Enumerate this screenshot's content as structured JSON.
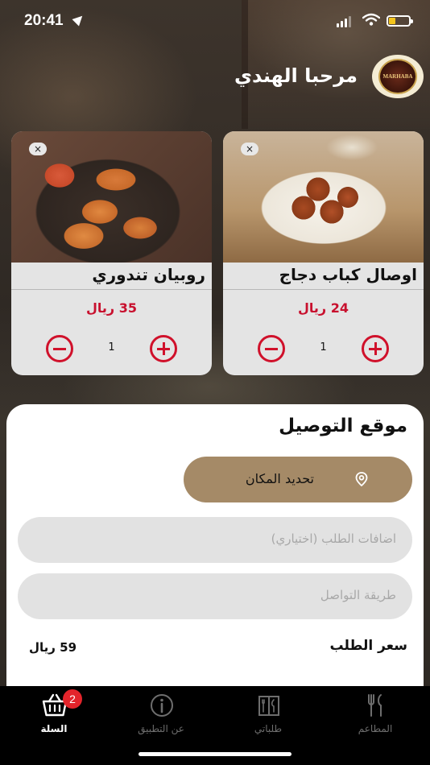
{
  "status_bar": {
    "time": "20:41",
    "icons": [
      "location-arrow-icon",
      "signal-icon",
      "wifi-icon",
      "battery-icon"
    ]
  },
  "header": {
    "greeting": "مرحبا الهندي",
    "logo_text": "MARHABA"
  },
  "cart_items": [
    {
      "name": "روبيان تندوري",
      "price": "35 ريال",
      "quantity": "1",
      "close": "×"
    },
    {
      "name": "اوصال كباب دجاج",
      "price": "24 ريال",
      "quantity": "1",
      "close": "×"
    }
  ],
  "delivery": {
    "title": "موقع التوصيل",
    "locate_label": "تحديد المكان",
    "notes_placeholder": "اضافات الطلب (اختياري)",
    "contact_placeholder": "طريقة التواصل",
    "total_label": "سعر الطلب",
    "total_value": "59 ريال"
  },
  "tabs": [
    {
      "label": "السلة",
      "icon": "basket-icon",
      "badge": "2",
      "active": true
    },
    {
      "label": "عن التطبيق",
      "icon": "info-icon",
      "active": false
    },
    {
      "label": "طلباتي",
      "icon": "menu-book-icon",
      "active": false
    },
    {
      "label": "المطاعم",
      "icon": "fork-knife-icon",
      "active": false
    }
  ],
  "colors": {
    "accent_red": "#d0112b",
    "price_red": "#c8102e",
    "locate_button": "#a58a67",
    "field_bg": "#e2e2e2",
    "badge": "#e3242b",
    "battery": "#f4c51c"
  }
}
